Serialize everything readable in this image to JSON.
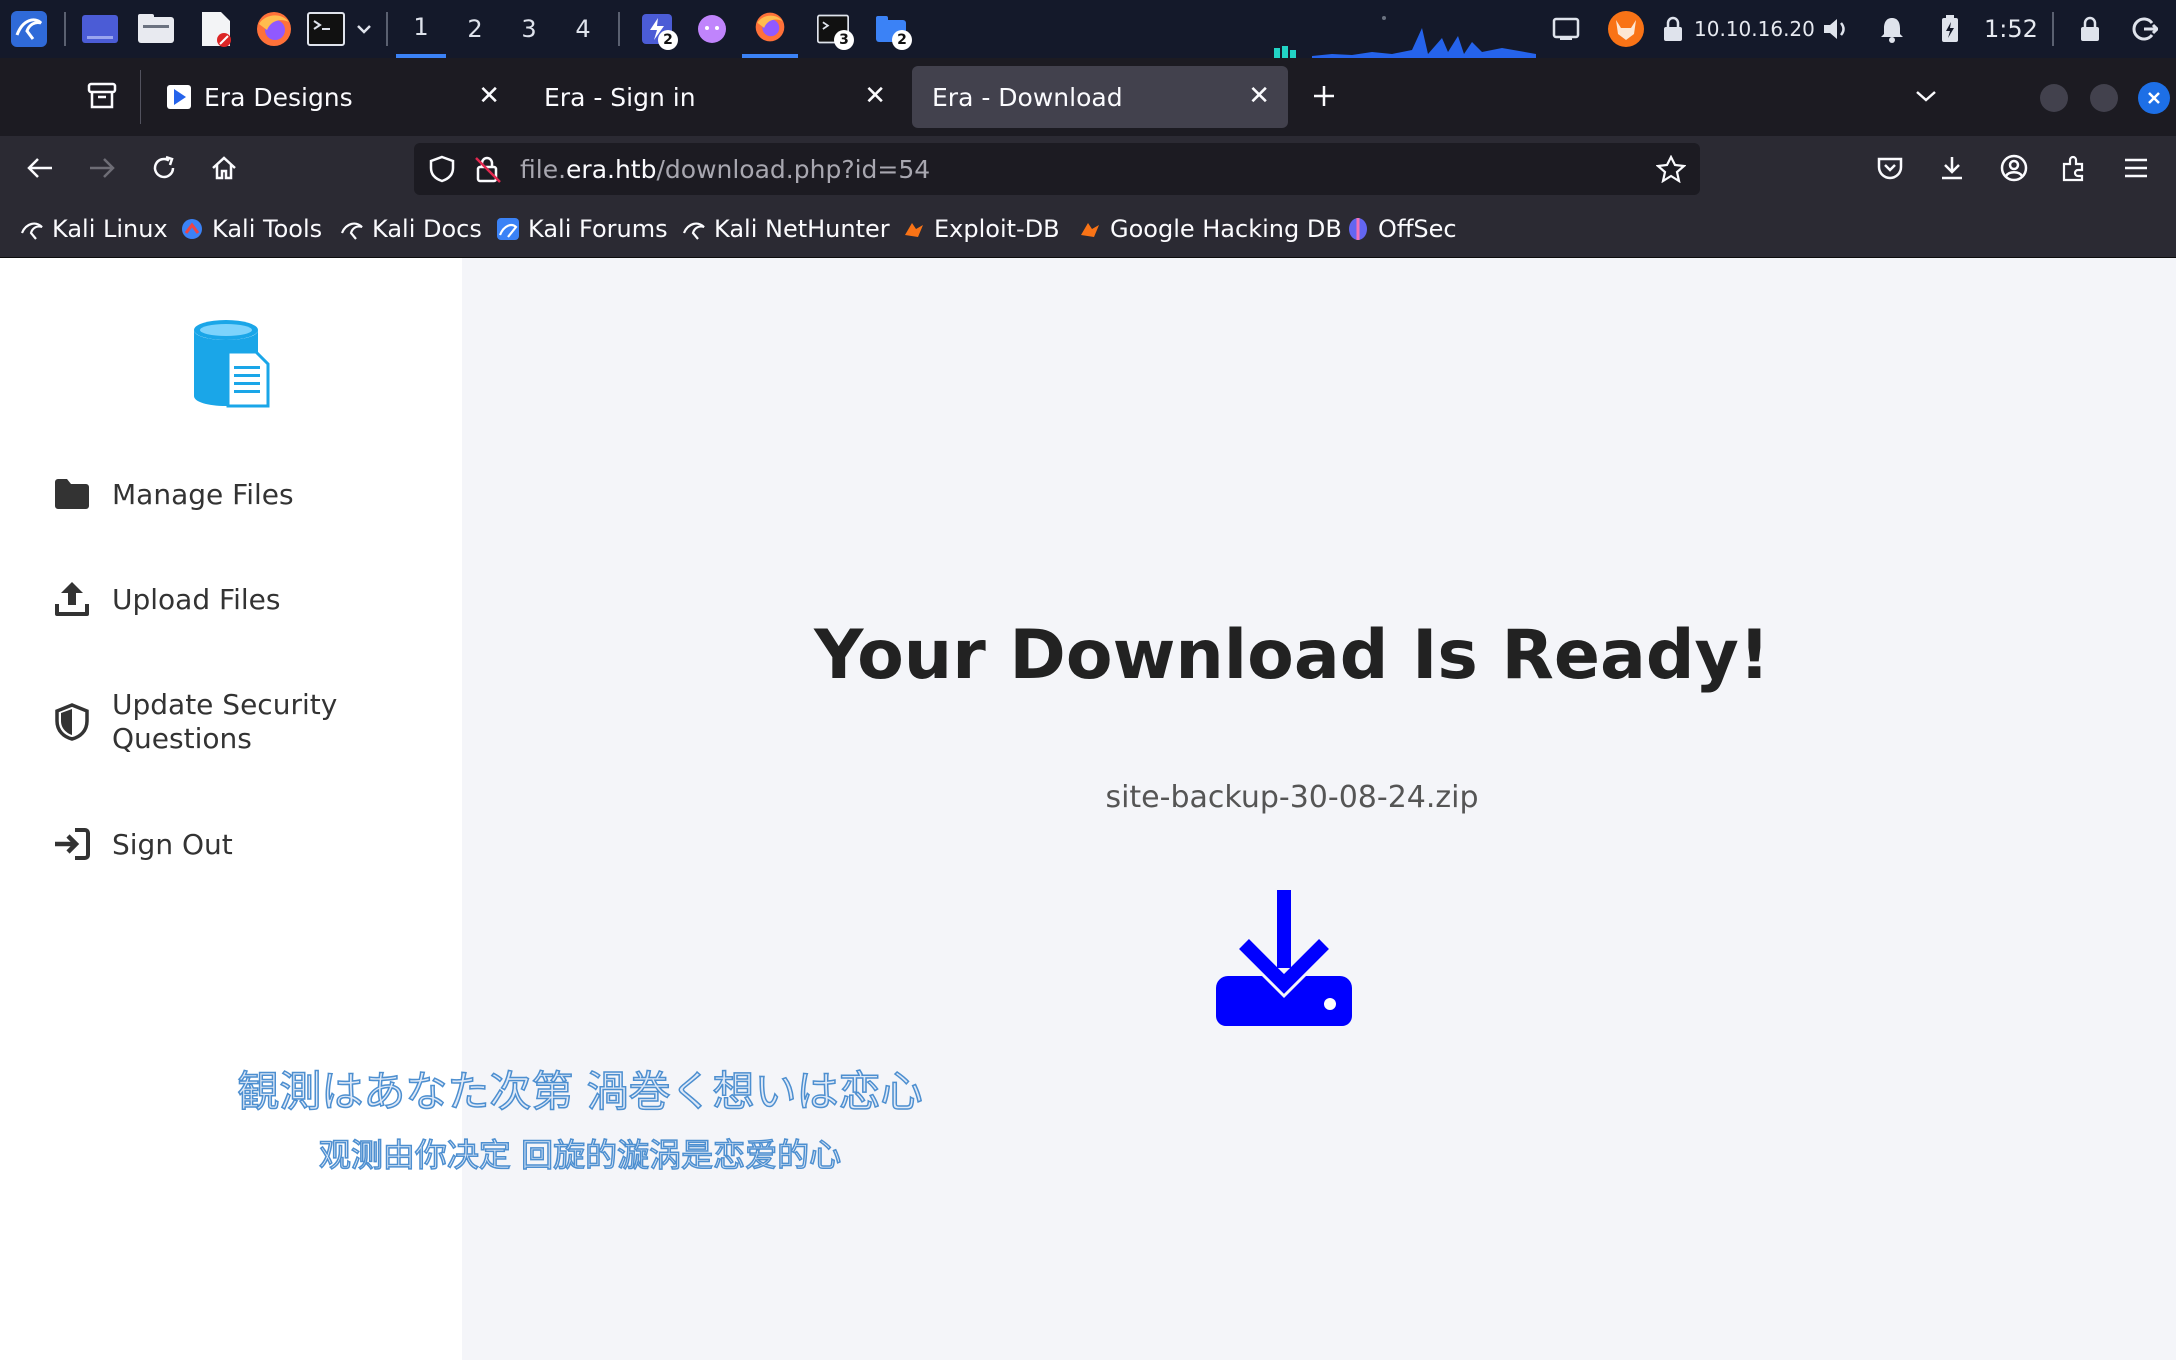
{
  "taskbar": {
    "workspaces": [
      "1",
      "2",
      "3",
      "4"
    ],
    "badges": {
      "app_a": "2",
      "terminal": "3",
      "app_b": "2"
    },
    "ip": "10.10.16.20",
    "clock": "1:52"
  },
  "tabs": [
    {
      "label": "Era Designs"
    },
    {
      "label": "Era - Sign in"
    },
    {
      "label": "Era - Download"
    }
  ],
  "nav": {
    "url_scheme_host_pre": "file.",
    "url_host": "era.htb",
    "url_path": "/download.php?id=54"
  },
  "bookmarks": [
    {
      "label": "Kali Linux"
    },
    {
      "label": "Kali Tools"
    },
    {
      "label": "Kali Docs"
    },
    {
      "label": "Kali Forums"
    },
    {
      "label": "Kali NetHunter"
    },
    {
      "label": "Exploit-DB"
    },
    {
      "label": "Google Hacking DB"
    },
    {
      "label": "OffSec"
    }
  ],
  "sidebar": {
    "items": [
      {
        "label": "Manage Files"
      },
      {
        "label": "Upload Files"
      },
      {
        "label": "Update Security Questions"
      },
      {
        "label": "Sign Out"
      }
    ]
  },
  "main": {
    "heading": "Your Download Is Ready!",
    "filename": "site-backup-30-08-24.zip"
  },
  "subtitles": {
    "line1": "観測はあなた次第 渦巻く想いは恋心",
    "line2": "观测由你决定 回旋的漩涡是恋爱的心"
  },
  "colors": {
    "accent": "#0000ff",
    "logo": "#1aa6e8",
    "taskbar": "#14192a",
    "tab_active": "#42414d"
  }
}
